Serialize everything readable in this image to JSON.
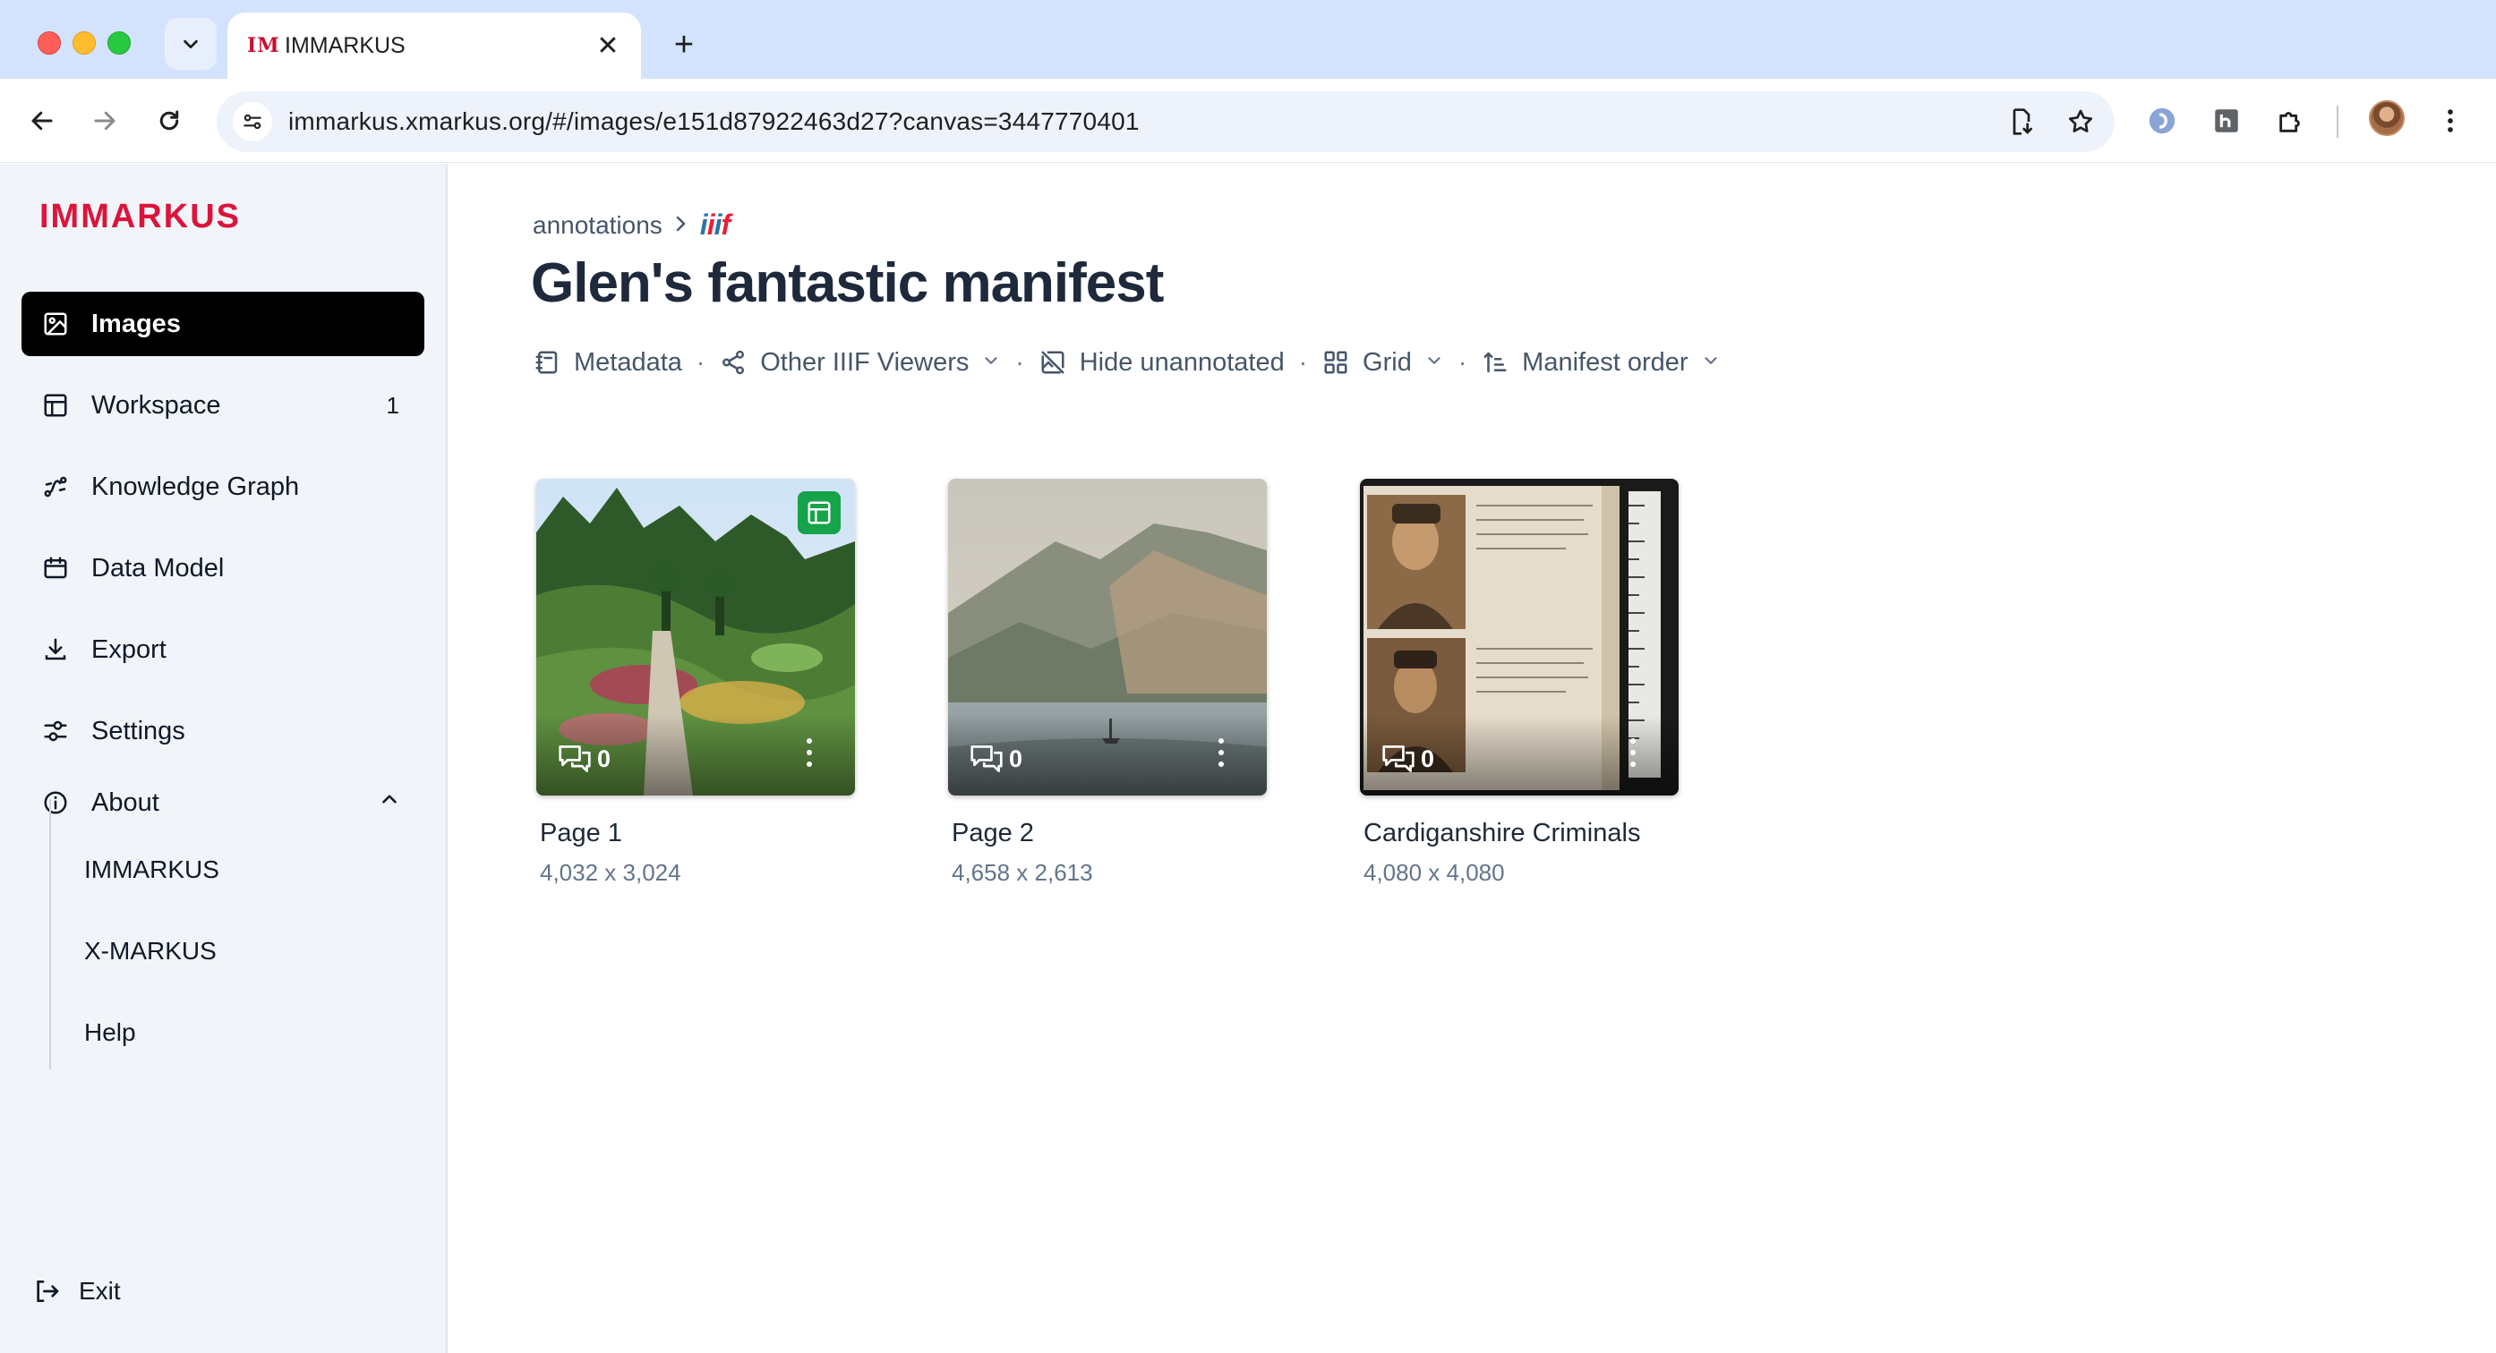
{
  "browser": {
    "tab_title": "IMMARKUS",
    "tab_favicon": "IM",
    "url": "immarkus.xmarkus.org/#/images/e151d87922463d27?canvas=3447770401",
    "icons": [
      "back-icon",
      "forward-icon",
      "reload-icon",
      "site-info-icon",
      "install-app-icon",
      "bookmark-star-icon",
      "extension-icon",
      "puzzle-icon",
      "kebab-menu-icon"
    ]
  },
  "sidebar": {
    "brand": "IMMARKUS",
    "items": [
      {
        "label": "Images",
        "icon": "image-icon",
        "active": true
      },
      {
        "label": "Workspace",
        "icon": "layout-icon",
        "count": "1"
      },
      {
        "label": "Knowledge Graph",
        "icon": "graph-icon"
      },
      {
        "label": "Data Model",
        "icon": "calendar-icon"
      },
      {
        "label": "Export",
        "icon": "download-icon"
      },
      {
        "label": "Settings",
        "icon": "sliders-icon"
      },
      {
        "label": "About",
        "icon": "info-icon",
        "expanded": true
      }
    ],
    "about_items": [
      "IMMARKUS",
      "X-MARKUS",
      "Help"
    ],
    "exit_label": "Exit"
  },
  "main": {
    "breadcrumb": {
      "parent": "annotations",
      "current": "iiif"
    },
    "title": "Glen's fantastic manifest",
    "actions": {
      "metadata": "Metadata",
      "viewers": "Other IIIF Viewers",
      "hide": "Hide unannotated",
      "grid": "Grid",
      "order": "Manifest order"
    },
    "cards": [
      {
        "title": "Page 1",
        "dims": "4,032 x 3,024",
        "comments": "0",
        "has_badge": true
      },
      {
        "title": "Page 2",
        "dims": "4,658 x 2,613",
        "comments": "0",
        "has_badge": false
      },
      {
        "title": "Cardiganshire Criminals",
        "dims": "4,080 x 4,080",
        "comments": "0",
        "has_badge": false
      }
    ]
  },
  "colors": {
    "brand": "#dc143c",
    "active_nav": "#000000",
    "badge_green": "#16a34a",
    "tabstrip": "#d3e3fd"
  }
}
